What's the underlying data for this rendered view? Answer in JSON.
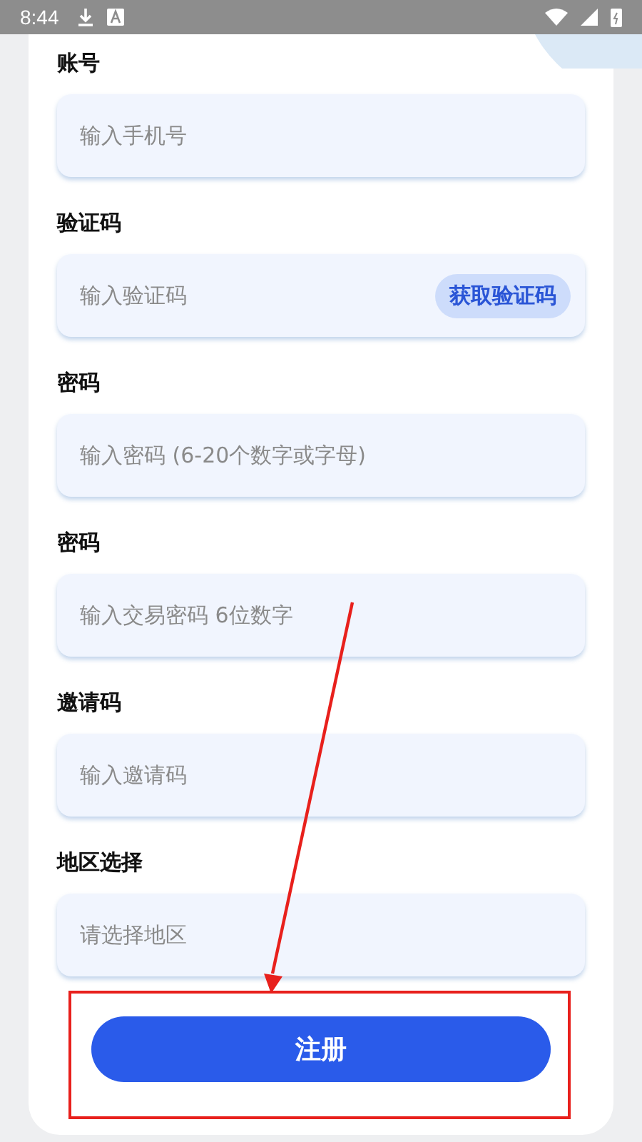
{
  "status_bar": {
    "time": "8:44"
  },
  "form": {
    "fields": [
      {
        "label": "账号",
        "kind": "text",
        "placeholder": "输入手机号"
      },
      {
        "label": "验证码",
        "kind": "code",
        "placeholder": "输入验证码",
        "action": "获取验证码"
      },
      {
        "label": "密码",
        "kind": "text",
        "placeholder": "输入密码 (6-20个数字或字母)"
      },
      {
        "label": "密码",
        "kind": "text",
        "placeholder": "输入交易密码 6位数字"
      },
      {
        "label": "邀请码",
        "kind": "text",
        "placeholder": "输入邀请码"
      },
      {
        "label": "地区选择",
        "kind": "select",
        "placeholder": "请选择地区"
      }
    ],
    "submit": "注册"
  }
}
